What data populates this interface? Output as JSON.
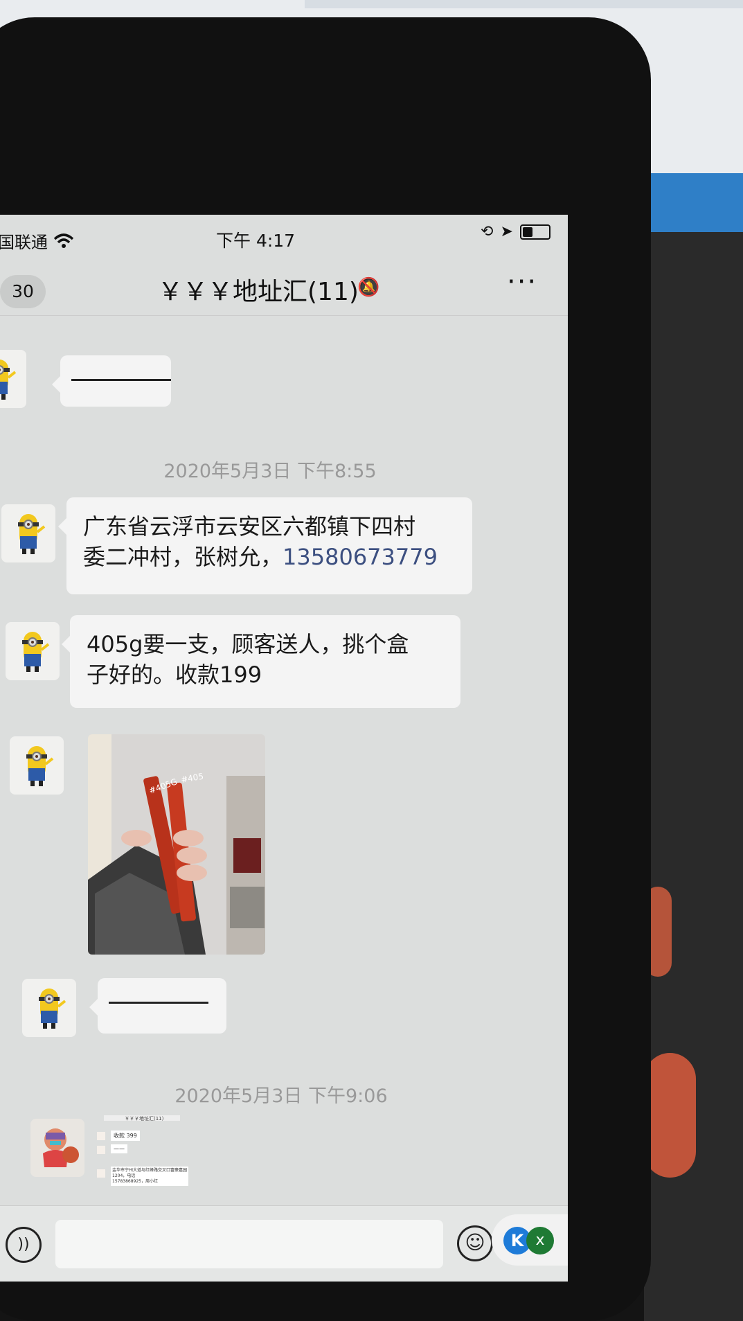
{
  "status_bar": {
    "carrier": "中国联通",
    "time": "下午 4:17"
  },
  "nav": {
    "unread_count": "30",
    "title": "￥￥￥地址汇(11)"
  },
  "messages": [
    {
      "type": "text",
      "text": "——————"
    },
    {
      "type": "timestamp",
      "text": "2020年5月3日 下午8:55"
    },
    {
      "type": "text",
      "text_line1": "广东省云浮市云安区六都镇下四村",
      "text_line2_prefix": "委二冲村，张树允，",
      "phone": "13580673779"
    },
    {
      "type": "text",
      "text_line1": "405g要一支，顾客送人，挑个盒",
      "text_line2": "子好的。收款199"
    },
    {
      "type": "image",
      "labels": [
        "#405G",
        "#405"
      ]
    },
    {
      "type": "text",
      "text": "——————"
    },
    {
      "type": "timestamp",
      "text": "2020年5月3日 下午9:06"
    },
    {
      "type": "image_screenshot",
      "title": "￥￥￥地址汇(11)",
      "line1": "收款 399",
      "line2": "——",
      "line3": "金华市宁州大道与红峰路交叉口富豪嘉园1204，电话",
      "line4": "15783868925，周小红"
    }
  ],
  "inputbar": {
    "emoji_icon": "emoji-face",
    "voice_icon": "voice-wave"
  },
  "overlay": {
    "k": "K",
    "x": "x"
  }
}
